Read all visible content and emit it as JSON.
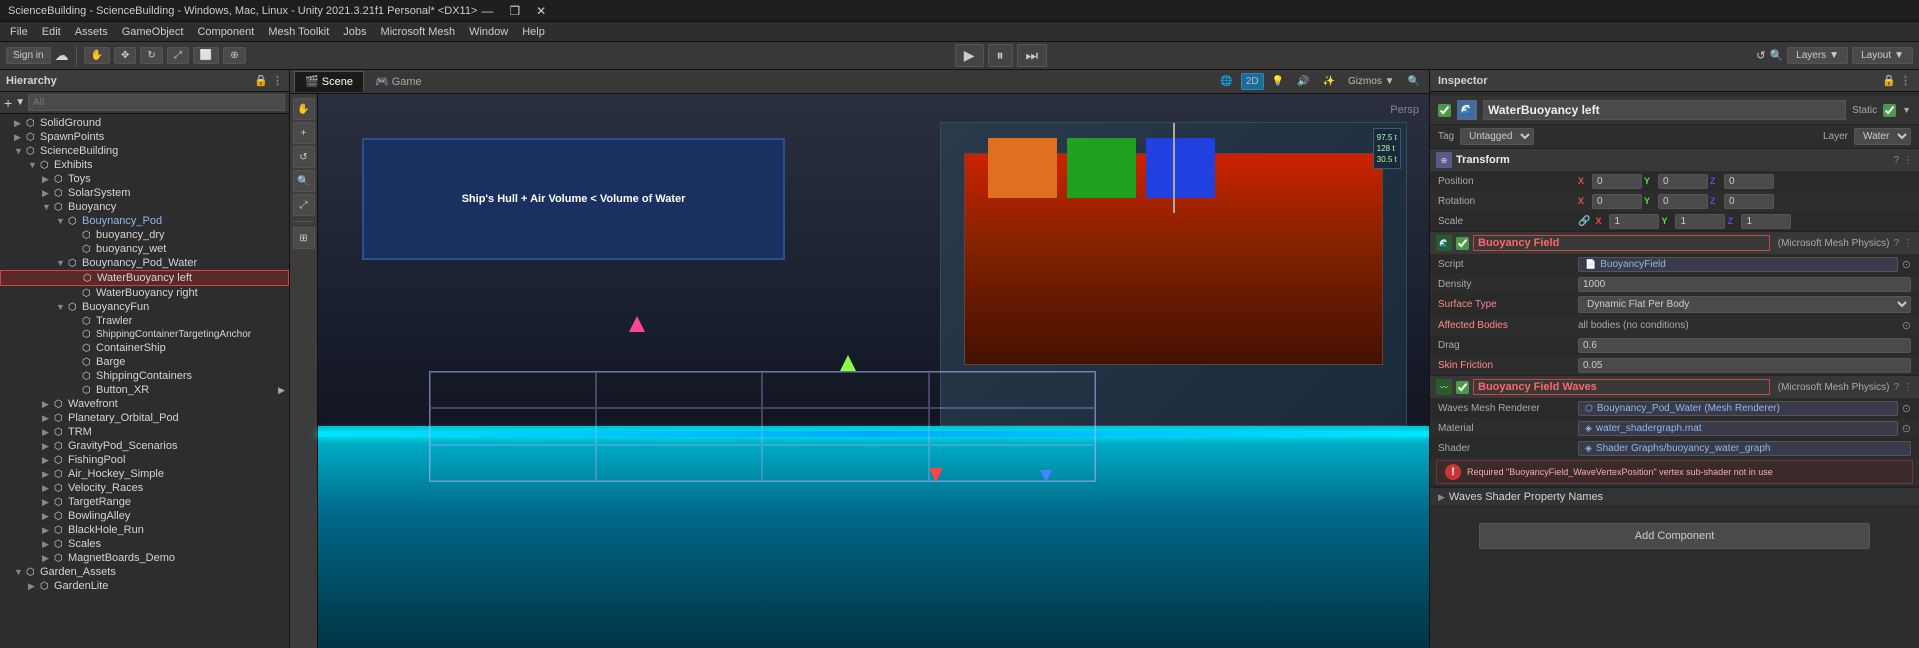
{
  "titlebar": {
    "title": "ScienceBuilding - ScienceBuilding - Windows, Mac, Linux - Unity 2021.3.21f1 Personal* <DX11>",
    "min": "—",
    "restore": "❐",
    "close": "✕"
  },
  "menubar": {
    "items": [
      "File",
      "Edit",
      "Assets",
      "GameObject",
      "Component",
      "Mesh Toolkit",
      "Jobs",
      "Microsoft Mesh",
      "Window",
      "Help"
    ]
  },
  "toolbar": {
    "sign_in": "Sign in",
    "cloud_icon": "☁",
    "play": "▶",
    "pause": "⏸",
    "step": "⏭",
    "undo_icon": "↺",
    "search_icon": "🔍",
    "layers_label": "Layers",
    "layout_label": "Layout"
  },
  "hierarchy": {
    "title": "Hierarchy",
    "search_placeholder": "All",
    "items": [
      {
        "label": "SolidGround",
        "depth": 0,
        "type": "scene",
        "expanded": false
      },
      {
        "label": "SpawnPoints",
        "depth": 0,
        "type": "scene",
        "expanded": false
      },
      {
        "label": "ScienceBuilding",
        "depth": 0,
        "type": "scene",
        "expanded": true
      },
      {
        "label": "Exhibits",
        "depth": 1,
        "type": "scene",
        "expanded": true
      },
      {
        "label": "Toys",
        "depth": 2,
        "type": "scene",
        "expanded": false
      },
      {
        "label": "SolarSystem",
        "depth": 2,
        "type": "scene",
        "expanded": false
      },
      {
        "label": "Buoyancy",
        "depth": 2,
        "type": "scene",
        "expanded": true
      },
      {
        "label": "Bouynancy_Pod",
        "depth": 3,
        "type": "prefab",
        "expanded": true
      },
      {
        "label": "buoyancy_dry",
        "depth": 4,
        "type": "scene",
        "expanded": false
      },
      {
        "label": "buoyancy_wet",
        "depth": 4,
        "type": "scene",
        "expanded": false
      },
      {
        "label": "Bouynancy_Pod_Water",
        "depth": 3,
        "type": "scene",
        "expanded": true
      },
      {
        "label": "WaterBuoyancy left",
        "depth": 4,
        "type": "selected",
        "expanded": false
      },
      {
        "label": "WaterBuoyancy right",
        "depth": 4,
        "type": "scene",
        "expanded": false
      },
      {
        "label": "BuoyancyFun",
        "depth": 3,
        "type": "scene",
        "expanded": true
      },
      {
        "label": "Trawler",
        "depth": 4,
        "type": "scene",
        "expanded": false
      },
      {
        "label": "ShippingContainerTargetingAnchor",
        "depth": 4,
        "type": "scene",
        "expanded": false
      },
      {
        "label": "ContainerShip",
        "depth": 4,
        "type": "scene",
        "expanded": false
      },
      {
        "label": "Barge",
        "depth": 4,
        "type": "scene",
        "expanded": false
      },
      {
        "label": "ShippingContainers",
        "depth": 4,
        "type": "scene",
        "expanded": false
      },
      {
        "label": "Button_XR",
        "depth": 4,
        "type": "scene",
        "expanded": false
      },
      {
        "label": "Wavefront",
        "depth": 2,
        "type": "scene",
        "expanded": false
      },
      {
        "label": "Planetary_Orbital_Pod",
        "depth": 2,
        "type": "scene",
        "expanded": false
      },
      {
        "label": "TRM",
        "depth": 2,
        "type": "scene",
        "expanded": false
      },
      {
        "label": "GravityPod_Scenarios",
        "depth": 2,
        "type": "scene",
        "expanded": false
      },
      {
        "label": "FishingPool",
        "depth": 2,
        "type": "scene",
        "expanded": false
      },
      {
        "label": "Air_Hockey_Simple",
        "depth": 2,
        "type": "scene",
        "expanded": false
      },
      {
        "label": "Velocity_Races",
        "depth": 2,
        "type": "scene",
        "expanded": false
      },
      {
        "label": "TargetRange",
        "depth": 2,
        "type": "scene",
        "expanded": false
      },
      {
        "label": "BowlingAlley",
        "depth": 2,
        "type": "scene",
        "expanded": false
      },
      {
        "label": "BlackHole_Run",
        "depth": 2,
        "type": "scene",
        "expanded": false
      },
      {
        "label": "Scales",
        "depth": 2,
        "type": "scene",
        "expanded": false
      },
      {
        "label": "MagnetBoards_Demo",
        "depth": 2,
        "type": "scene",
        "expanded": false
      },
      {
        "label": "Garden_Assets",
        "depth": 0,
        "type": "scene",
        "expanded": true
      },
      {
        "label": "GardenLite",
        "depth": 1,
        "type": "scene",
        "expanded": false
      }
    ]
  },
  "scene": {
    "tabs": [
      "Scene",
      "Game"
    ],
    "active_tab": "Scene",
    "persp_label": "Persp",
    "banner_text": "Ship's Hull + Air Volume < Volume of Water",
    "tools": [
      "hand",
      "move",
      "rotate",
      "scale",
      "rect",
      "transform"
    ],
    "view_2d": "2D",
    "gizmos": "Gizmos"
  },
  "inspector": {
    "title": "Inspector",
    "object_name": "WaterBuoyancy left",
    "object_icon": "🌊",
    "static_label": "Static",
    "static_checked": true,
    "tag_label": "Tag",
    "tag_value": "Untagged",
    "layer_label": "Layer",
    "layer_value": "Water",
    "transform": {
      "title": "Transform",
      "position_label": "Position",
      "position": {
        "x": "0",
        "y": "0",
        "z": "0"
      },
      "rotation_label": "Rotation",
      "rotation": {
        "x": "0",
        "y": "0",
        "z": "0"
      },
      "scale_label": "Scale",
      "scale": {
        "x": "1",
        "y": "1",
        "z": "1"
      },
      "scale_link": true
    },
    "buoyancy_field": {
      "title": "Buoyancy Field",
      "subtitle": "(Microsoft Mesh Physics)",
      "checked": true,
      "highlighted": true,
      "script_label": "Script",
      "script_value": "BuoyancyField",
      "density_label": "Density",
      "density_value": "1000",
      "surface_type_label": "Surface Type",
      "surface_type_value": "Dynamic Flat Per Body",
      "affected_bodies_label": "Affected Bodies",
      "affected_bodies_value": "all bodies (no conditions)",
      "drag_label": "Drag",
      "drag_value": "0.6",
      "skin_friction_label": "Skin Friction",
      "skin_friction_value": "0.05"
    },
    "buoyancy_field_waves": {
      "title": "Buoyancy Field Waves",
      "subtitle": "(Microsoft Mesh Physics)",
      "checked": true,
      "highlighted": true,
      "waves_mesh_renderer_label": "Waves Mesh Renderer",
      "waves_mesh_renderer_value": "Bouynancy_Pod_Water (Mesh Renderer)",
      "material_label": "Material",
      "material_value": "water_shadergraph.mat",
      "shader_label": "Shader",
      "shader_value": "Shader Graphs/buoyancy_water_graph",
      "error_text": "Required \"BuoyancyField_WaveVertexPosition\" vertex sub-shader not in use"
    },
    "waves_shader_property_names": "Waves Shader Property Names",
    "add_component_label": "Add Component"
  }
}
